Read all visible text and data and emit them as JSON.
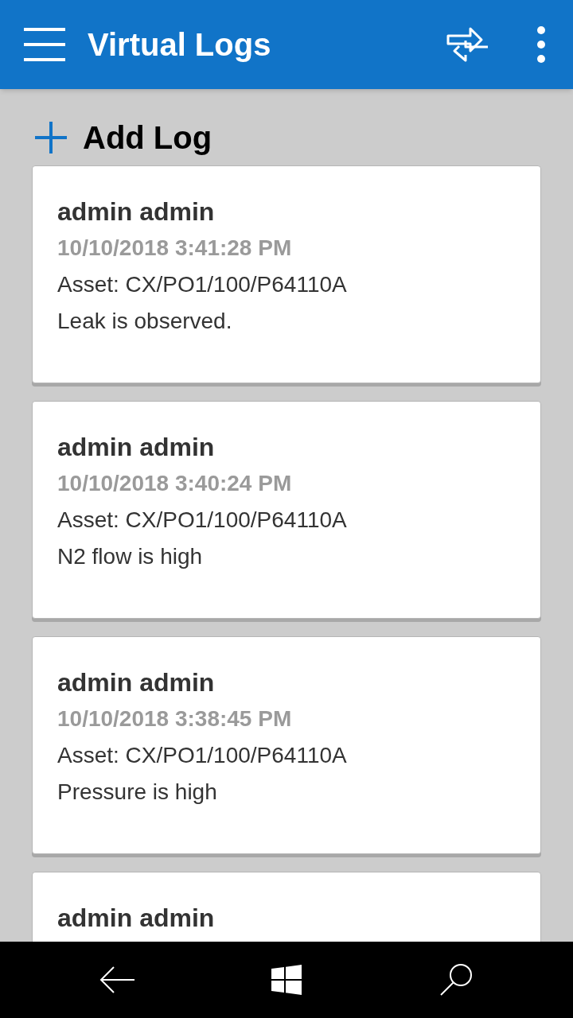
{
  "app_bar": {
    "title": "Virtual Logs"
  },
  "add_button": {
    "label": "Add Log"
  },
  "logs": [
    {
      "author": "admin admin",
      "timestamp": "10/10/2018 3:41:28 PM",
      "asset": "Asset: CX/PO1/100/P64110A",
      "message": "Leak is observed."
    },
    {
      "author": "admin admin",
      "timestamp": "10/10/2018 3:40:24 PM",
      "asset": "Asset: CX/PO1/100/P64110A",
      "message": "N2 flow is high"
    },
    {
      "author": "admin admin",
      "timestamp": "10/10/2018 3:38:45 PM",
      "asset": "Asset: CX/PO1/100/P64110A",
      "message": "Pressure is high"
    },
    {
      "author": "admin admin"
    }
  ]
}
